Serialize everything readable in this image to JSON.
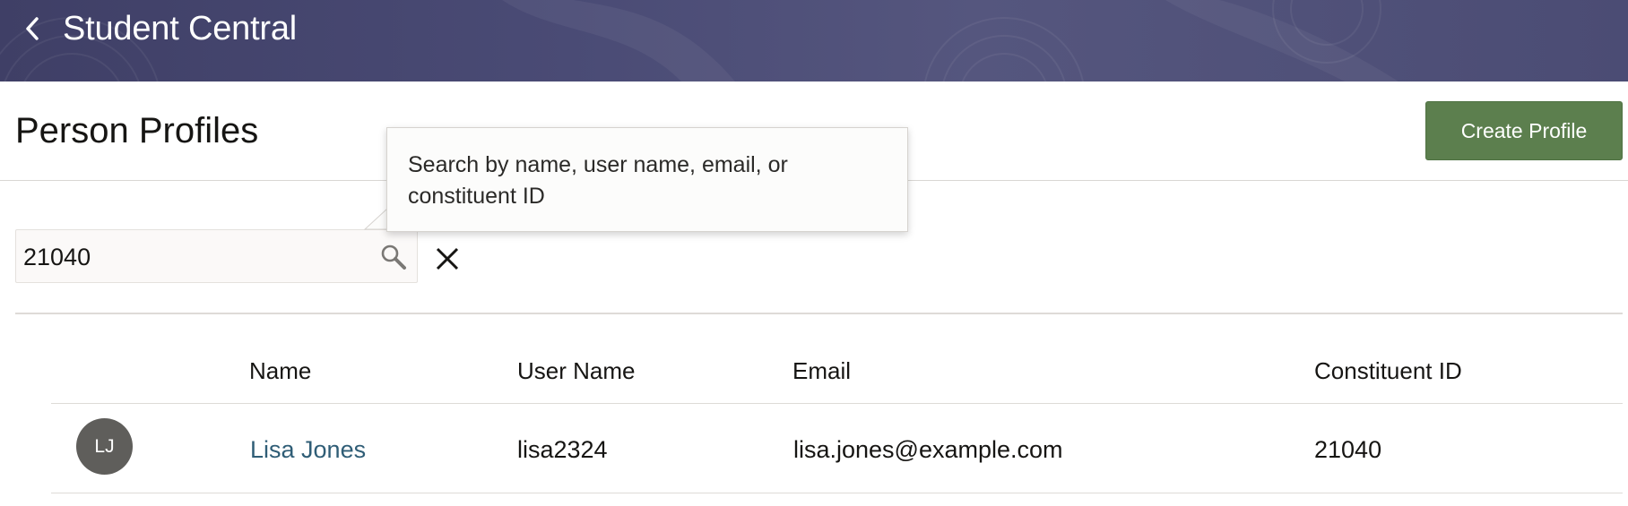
{
  "header": {
    "title": "Student Central",
    "back_icon": "chevron-left-icon"
  },
  "page": {
    "title": "Person Profiles",
    "create_button": "Create Profile"
  },
  "search": {
    "value": "21040",
    "tooltip": "Search by name, user name, email, or constituent ID",
    "search_icon": "search-icon",
    "clear_icon": "close-icon"
  },
  "table": {
    "columns": [
      "Name",
      "User Name",
      "Email",
      "Constituent ID"
    ],
    "rows": [
      {
        "initials": "LJ",
        "name": "Lisa Jones",
        "user_name": "lisa2324",
        "email": "lisa.jones@example.com",
        "constituent_id": "21040"
      }
    ]
  },
  "colors": {
    "banner": "#4a4b75",
    "primary_button": "#5c7f4e",
    "link": "#2f5d76",
    "avatar": "#5f5e5b"
  }
}
